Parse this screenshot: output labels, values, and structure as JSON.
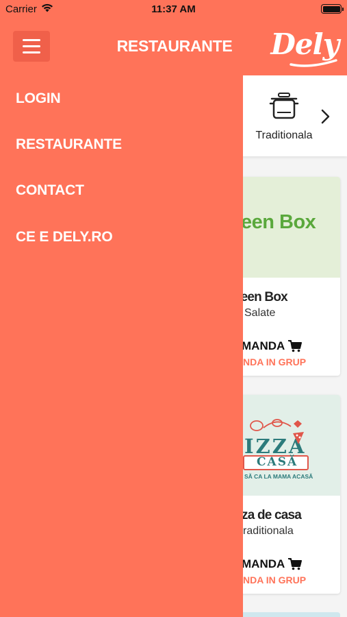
{
  "status_bar": {
    "carrier": "Carrier",
    "time": "11:37 AM"
  },
  "header": {
    "title": "RESTAURANTE",
    "logo_text": "Dely"
  },
  "drawer": {
    "items": [
      {
        "label": "LOGIN"
      },
      {
        "label": "RESTAURANTE"
      },
      {
        "label": "CONTACT"
      },
      {
        "label": "CE E DELY.RO"
      }
    ]
  },
  "categories": {
    "visible": "Traditionala",
    "next_icon": "chevron-right-icon"
  },
  "restaurants": [
    {
      "name": "reen Box",
      "category": "Salate",
      "logo_text": "een Box",
      "order_label": "MANDA",
      "group_order_label": "NDA IN GRUP"
    },
    {
      "name": "za de casa",
      "category": "raditionala",
      "logo_text": "IZZA",
      "logo_subtext": "CASĂ",
      "logo_tagline": "SĂ CA LA MAMA ACASĂ",
      "order_label": "MANDA",
      "group_order_label": "NDA IN GRUP"
    }
  ],
  "colors": {
    "brand": "#ff7359",
    "menu_button": "#f0604a",
    "greenbox_bg": "#e4efd8",
    "greenbox_text": "#5aa83c",
    "pizza_bg": "#e2efe8",
    "pizza_text": "#2c7b7b",
    "pizza_accent": "#e0564a"
  }
}
